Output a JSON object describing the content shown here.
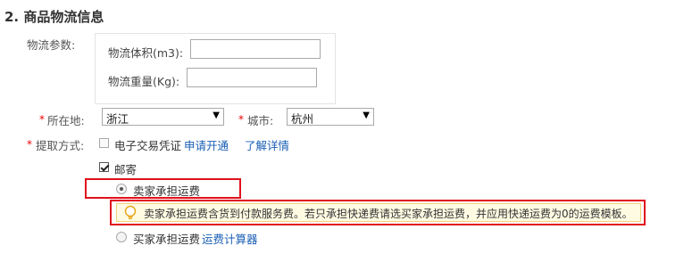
{
  "section": {
    "title": "2. 商品物流信息"
  },
  "logistics_params": {
    "label": "物流参数:",
    "volume_label": "物流体积(m3):",
    "volume_value": "",
    "weight_label": "物流重量(Kg):",
    "weight_value": ""
  },
  "location": {
    "required_mark": "*",
    "province_label": "所在地:",
    "province_value": "浙江",
    "city_label": "城市:",
    "city_value": "杭州"
  },
  "pickup": {
    "required_mark": "*",
    "label": "提取方式:",
    "e_voucher_label": "电子交易凭证",
    "e_voucher_checked": false,
    "apply_link": "申请开通",
    "details_link": "了解详情",
    "mail_label": "邮寄",
    "mail_checked": true
  },
  "shipping": {
    "option1_label": "卖家承担运费",
    "option1_selected": true,
    "tip_text": "卖家承担运费含货到付款服务费。若只承担快递费请选买家承担运费，并应用快递运费为0的运费模板。",
    "option2_label": "买家承担运费",
    "option2_selected": false,
    "calculator_link": "运费计算器"
  },
  "colors": {
    "link": "#1a5fb4",
    "required": "#e00000",
    "highlight_border": "#e0101c",
    "tip_bg": "#fffbe3"
  },
  "icons": {
    "select_arrow": "triangle-down",
    "tip": "lightbulb-icon"
  }
}
